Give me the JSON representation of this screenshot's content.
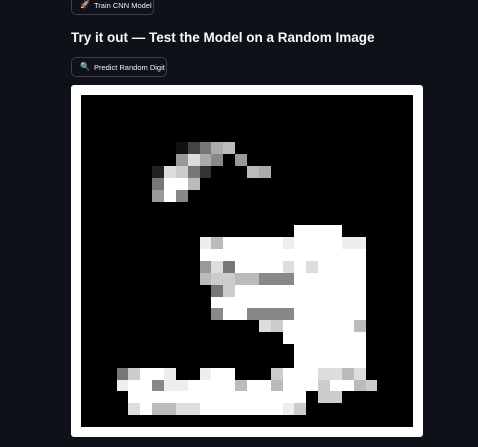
{
  "train_button": {
    "label": "Train CNN Model",
    "icon": "rocket-icon",
    "glyph": "🚀"
  },
  "section": {
    "title": "Try it out — Test the Model on a Random Image"
  },
  "predict_button": {
    "label": "Predict Random Digit",
    "icon": "magnifier-icon",
    "glyph": "🔍"
  },
  "digit_image": {
    "width": 28,
    "height": 28,
    "pixels": [
      "............................",
      "............................",
      "............................",
      "............................",
      "........147ab...............",
      "........9da8.9..............",
      "......2dc73...ba............",
      "......7ffb..................",
      "......9f8...................",
      "............................",
      "............................",
      "..................ffff......",
      "..........ebfffffeffffee....",
      "..........ffffffffffffff....",
      "..........9d7ffffdfdffff....",
      "..........bccbb888ffffff....",
      "...........7cfffffffffff....",
      "...........fffffffffffff....",
      "...........8ff8888ffffff....",
      "...............dcffffffb....",
      ".................fffffff....",
      "..................ffffff....",
      "..................ffffff....",
      "...7cffe..eff...cfffddbd....",
      "...eff8eeffffbffbfffcffbc...",
      "....fffffffffffffff.cc......",
      "....dfbbddfffffffec.........",
      "............................"
    ]
  }
}
